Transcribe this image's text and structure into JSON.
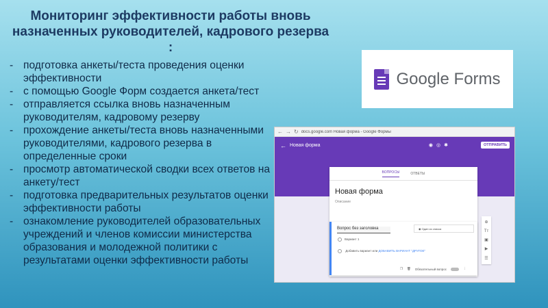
{
  "slide": {
    "title": "Мониторинг эффективности работы вновь назначенных руководителей, кадрового резерва :",
    "bullets": [
      "подготовка анкеты/теста проведения оценки эффективности",
      "с помощью Google Форм создается анкета/тест",
      "отправляется ссылка вновь назначенным руководителям, кадровому резерву",
      "прохождение анкеты/теста вновь назначенными руководителями, кадрового резерва в определенные сроки",
      "просмотр автоматической сводки всех ответов на анкету/тест",
      "подготовка предварительных результатов оценки эффективности работы",
      "ознакомление руководителей образовательных учреждений и членов комиссии министерства образования и молодежной  политики с результатами оценки эффективности работы"
    ]
  },
  "logo": {
    "text_google": "Google",
    "text_forms": "Forms",
    "icon": "google-forms-icon",
    "brand_color": "#673ab7"
  },
  "browser": {
    "url": "docs.google.com   Новая форма - Google Формы",
    "form_name": "Новая форма",
    "send_label": "ОТПРАВИТЬ",
    "tabs": [
      "ВОПРОСЫ",
      "ОТВЕТЫ"
    ],
    "form_title": "Новая форма",
    "form_description": "Описание",
    "question_title": "Вопрос без заголовка",
    "question_type": "Один из списка",
    "option_1": "Вариант 1",
    "add_option": "Добавить вариант или",
    "add_other": "ДОБАВИТЬ ВАРИАНТ \"ДРУГОЕ\"",
    "required_label": "Обязательный вопрос",
    "accent_color": "#673ab7"
  }
}
